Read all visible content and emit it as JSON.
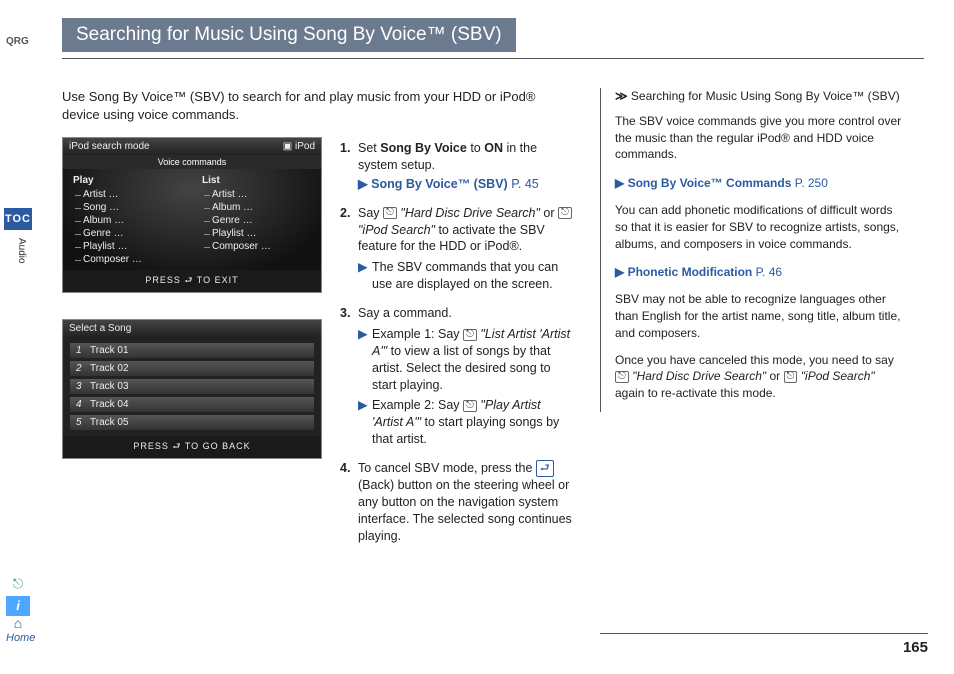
{
  "rail": {
    "qrg": "QRG",
    "toc": "TOC",
    "vert": "Audio",
    "home": "Home"
  },
  "title": "Searching for Music Using Song By Voice™ (SBV)",
  "intro": "Use Song By Voice™ (SBV) to search for and play music from your HDD or iPod® device using voice commands.",
  "ss1": {
    "bar": "iPod search mode",
    "badge": "iPod",
    "sub": "Voice commands",
    "left_head": "Play",
    "right_head": "List",
    "left": [
      "Artist …",
      "Song …",
      "Album …",
      "Genre …",
      "Playlist …",
      "Composer …"
    ],
    "right": [
      "Artist …",
      "Album …",
      "Genre …",
      "Playlist …",
      "Composer …"
    ],
    "foot": "PRESS ⮐ TO EXIT"
  },
  "ss2": {
    "bar": "Select a Song",
    "tracks": [
      [
        "1",
        "Track 01"
      ],
      [
        "2",
        "Track 02"
      ],
      [
        "3",
        "Track 03"
      ],
      [
        "4",
        "Track 04"
      ],
      [
        "5",
        "Track 05"
      ]
    ],
    "foot": "PRESS ⮐ TO GO BACK"
  },
  "steps": {
    "s1_a": "Set ",
    "s1_b": "Song By Voice",
    "s1_c": " to ",
    "s1_d": "ON",
    "s1_e": " in the system setup.",
    "s1_xref": "Song By Voice™ (SBV)",
    "s1_page": "P. 45",
    "s2_a": "Say ",
    "s2_q1": "\"Hard Disc Drive Search\"",
    "s2_or": " or ",
    "s2_q2": "\"iPod Search\"",
    "s2_b": " to activate the SBV feature for the HDD or iPod®.",
    "s2_sub": "The SBV commands that you can use are displayed on the screen.",
    "s3_a": "Say a command.",
    "s3_e1a": "Example 1: Say ",
    "s3_e1b": "\"List Artist 'Artist A'\"",
    "s3_e1c": " to view a list of songs by that artist. Select the desired song to start playing.",
    "s3_e2a": "Example 2: Say ",
    "s3_e2b": "\"Play Artist 'Artist A'\"",
    "s3_e2c": " to start playing songs by that artist.",
    "s4_a": "To cancel SBV mode, press the ",
    "s4_b": " (Back) button on the steering wheel or any button on the navigation system interface. The selected song continues playing."
  },
  "side": {
    "head_arrow": "≫",
    "head": "Searching for Music Using Song By Voice™ (SBV)",
    "p1": "The SBV voice commands give you more control over the music than the regular iPod® and HDD voice commands.",
    "x1": "Song By Voice™ Commands",
    "x1p": "P. 250",
    "p2": "You can add phonetic modifications of difficult words so that it is easier for SBV to recognize artists, songs, albums, and composers in voice commands.",
    "x2": "Phonetic Modification",
    "x2p": "P. 46",
    "p3": "SBV may not be able to recognize languages other than English for the artist name, song title, album title, and composers.",
    "p4a": "Once you have canceled this mode, you need to say ",
    "p4q1": "\"Hard Disc Drive Search\"",
    "p4or": " or ",
    "p4q2": "\"iPod Search\"",
    "p4b": " again to re-activate this mode."
  },
  "page": "165"
}
